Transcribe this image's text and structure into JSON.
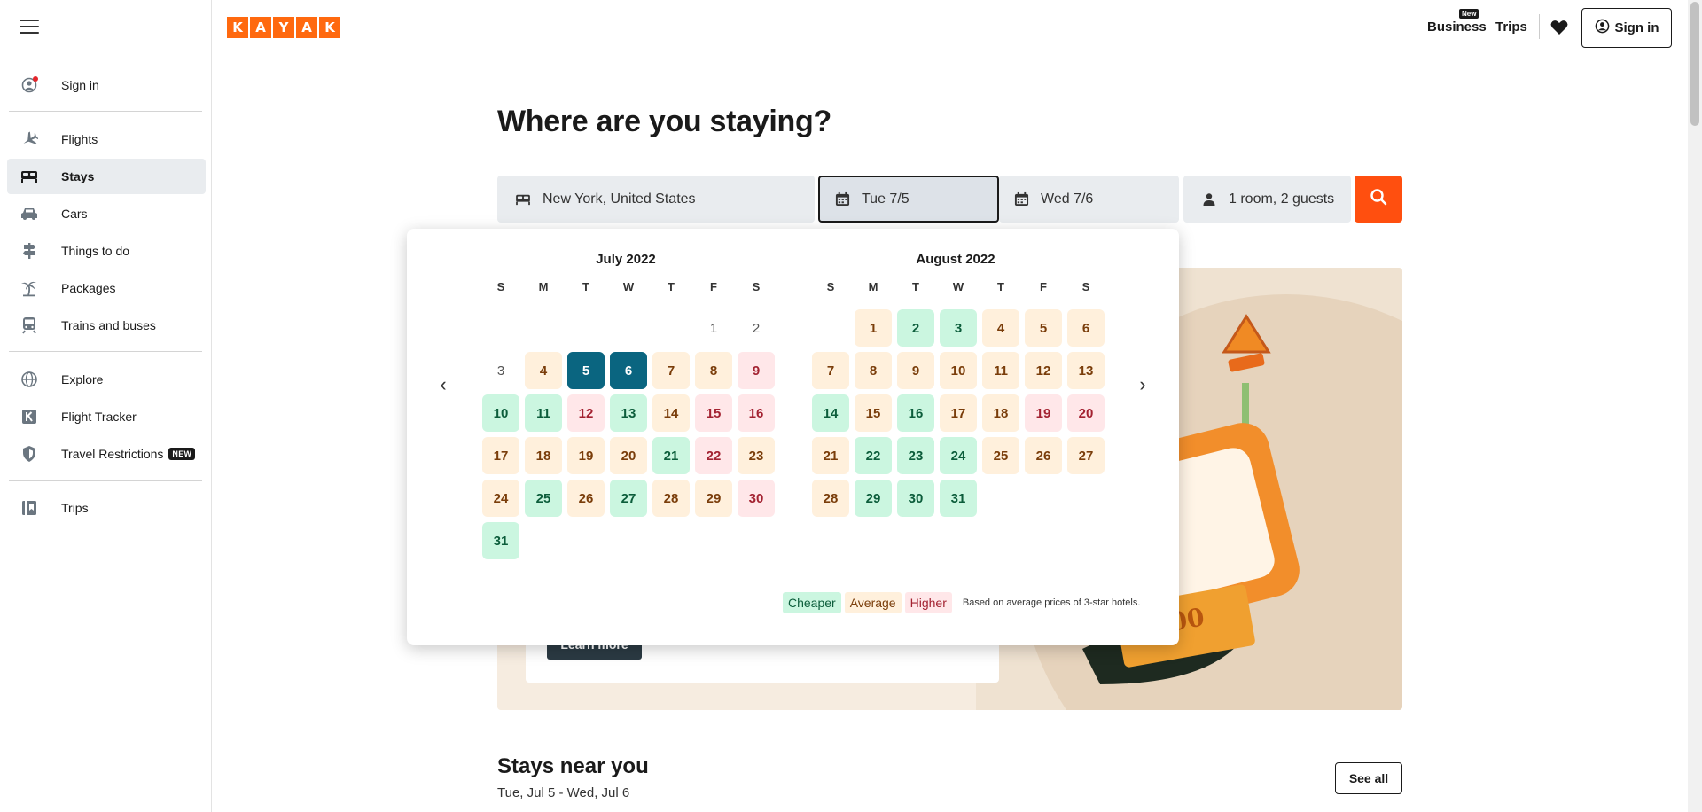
{
  "app": {
    "logo_letters": [
      "K",
      "A",
      "Y",
      "A",
      "K"
    ],
    "accent": "#ff690f"
  },
  "sidebar": {
    "items": [
      {
        "label": "Sign in",
        "icon": "user-icon"
      },
      {
        "label": "Flights",
        "icon": "plane-icon"
      },
      {
        "label": "Stays",
        "icon": "bed-icon",
        "active": true
      },
      {
        "label": "Cars",
        "icon": "car-icon"
      },
      {
        "label": "Things to do",
        "icon": "signpost-icon"
      },
      {
        "label": "Packages",
        "icon": "palm-icon"
      },
      {
        "label": "Trains and buses",
        "icon": "train-icon"
      },
      {
        "label": "Explore",
        "icon": "globe-icon"
      },
      {
        "label": "Flight Tracker",
        "icon": "k-icon"
      },
      {
        "label": "Travel Restrictions",
        "icon": "shield-icon",
        "badge": "NEW"
      },
      {
        "label": "Trips",
        "icon": "trips-icon"
      }
    ]
  },
  "header": {
    "business": "Business",
    "business_badge": "New",
    "trips": "Trips",
    "sign_in": "Sign in"
  },
  "main": {
    "title": "Where are you staying?",
    "search": {
      "destination": "New York, United States",
      "checkin": "Tue 7/5",
      "checkout": "Wed 7/6",
      "guests": "1 room, 2 guests"
    },
    "promo": {
      "learn_more": "Learn more"
    },
    "near": {
      "title": "Stays near you",
      "dates": "Tue, Jul 5 - Wed, Jul 6",
      "see_all": "See all"
    }
  },
  "calendar": {
    "weekdays": [
      "S",
      "M",
      "T",
      "W",
      "T",
      "F",
      "S"
    ],
    "months": [
      {
        "title": "July 2022",
        "offset": 5,
        "days": [
          {
            "d": "1",
            "p": "n"
          },
          {
            "d": "2",
            "p": "n"
          },
          {
            "d": "3",
            "p": "n"
          },
          {
            "d": "4",
            "p": "a"
          },
          {
            "d": "5",
            "p": "s"
          },
          {
            "d": "6",
            "p": "s"
          },
          {
            "d": "7",
            "p": "a"
          },
          {
            "d": "8",
            "p": "a"
          },
          {
            "d": "9",
            "p": "h"
          },
          {
            "d": "10",
            "p": "c"
          },
          {
            "d": "11",
            "p": "c"
          },
          {
            "d": "12",
            "p": "h"
          },
          {
            "d": "13",
            "p": "c"
          },
          {
            "d": "14",
            "p": "a"
          },
          {
            "d": "15",
            "p": "h"
          },
          {
            "d": "16",
            "p": "h"
          },
          {
            "d": "17",
            "p": "a"
          },
          {
            "d": "18",
            "p": "a"
          },
          {
            "d": "19",
            "p": "a"
          },
          {
            "d": "20",
            "p": "a"
          },
          {
            "d": "21",
            "p": "c"
          },
          {
            "d": "22",
            "p": "h"
          },
          {
            "d": "23",
            "p": "a"
          },
          {
            "d": "24",
            "p": "a"
          },
          {
            "d": "25",
            "p": "c"
          },
          {
            "d": "26",
            "p": "a"
          },
          {
            "d": "27",
            "p": "c"
          },
          {
            "d": "28",
            "p": "a"
          },
          {
            "d": "29",
            "p": "a"
          },
          {
            "d": "30",
            "p": "h"
          },
          {
            "d": "31",
            "p": "c"
          }
        ]
      },
      {
        "title": "August 2022",
        "offset": 1,
        "days": [
          {
            "d": "1",
            "p": "a"
          },
          {
            "d": "2",
            "p": "c"
          },
          {
            "d": "3",
            "p": "c"
          },
          {
            "d": "4",
            "p": "a"
          },
          {
            "d": "5",
            "p": "a"
          },
          {
            "d": "6",
            "p": "a"
          },
          {
            "d": "7",
            "p": "a"
          },
          {
            "d": "8",
            "p": "a"
          },
          {
            "d": "9",
            "p": "a"
          },
          {
            "d": "10",
            "p": "a"
          },
          {
            "d": "11",
            "p": "a"
          },
          {
            "d": "12",
            "p": "a"
          },
          {
            "d": "13",
            "p": "a"
          },
          {
            "d": "14",
            "p": "c"
          },
          {
            "d": "15",
            "p": "a"
          },
          {
            "d": "16",
            "p": "c"
          },
          {
            "d": "17",
            "p": "a"
          },
          {
            "d": "18",
            "p": "a"
          },
          {
            "d": "19",
            "p": "h"
          },
          {
            "d": "20",
            "p": "h"
          },
          {
            "d": "21",
            "p": "a"
          },
          {
            "d": "22",
            "p": "c"
          },
          {
            "d": "23",
            "p": "c"
          },
          {
            "d": "24",
            "p": "c"
          },
          {
            "d": "25",
            "p": "a"
          },
          {
            "d": "26",
            "p": "a"
          },
          {
            "d": "27",
            "p": "a"
          },
          {
            "d": "28",
            "p": "a"
          },
          {
            "d": "29",
            "p": "c"
          },
          {
            "d": "30",
            "p": "c"
          },
          {
            "d": "31",
            "p": "c"
          }
        ]
      }
    ],
    "legend": {
      "cheaper": "Cheaper",
      "average": "Average",
      "higher": "Higher",
      "note": "Based on average prices of 3-star hotels."
    },
    "colors": {
      "cheaper": "#cbf6e0",
      "average": "#fff0dc",
      "higher": "#ffe7e9",
      "selected": "#0a6580"
    }
  }
}
